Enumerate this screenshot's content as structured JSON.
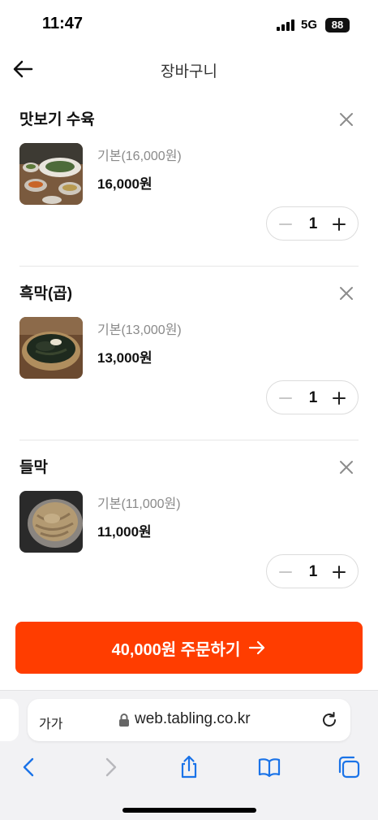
{
  "status_bar": {
    "time": "11:47",
    "network": "5G",
    "battery": "88"
  },
  "header": {
    "title": "장바구니"
  },
  "cart": {
    "items": [
      {
        "name": "맛보기 수육",
        "option": "기본(16,000원)",
        "price": "16,000원",
        "quantity": "1",
        "image": "boiled-pork-platter"
      },
      {
        "name": "흑막(곱)",
        "option": "기본(13,000원)",
        "price": "13,000원",
        "quantity": "1",
        "image": "black-noodle-bowl"
      },
      {
        "name": "들막",
        "option": "기본(11,000원)",
        "price": "11,000원",
        "quantity": "1",
        "image": "perilla-noodle-bowl"
      }
    ]
  },
  "order_button": {
    "label": "40,000원 주문하기"
  },
  "browser": {
    "aa_label": "가가",
    "url": "web.tabling.co.kr"
  },
  "colors": {
    "accent": "#ff3d00",
    "divider": "#e6e6e6",
    "muted_text": "#8a8a8a",
    "browser_blue": "#1a73e8"
  },
  "icons": [
    "back-arrow-icon",
    "close-icon",
    "minus-icon",
    "plus-icon",
    "arrow-right-icon",
    "lock-icon",
    "reload-icon",
    "chevron-left-icon",
    "chevron-right-icon",
    "share-icon",
    "bookmarks-icon",
    "tabs-icon"
  ]
}
